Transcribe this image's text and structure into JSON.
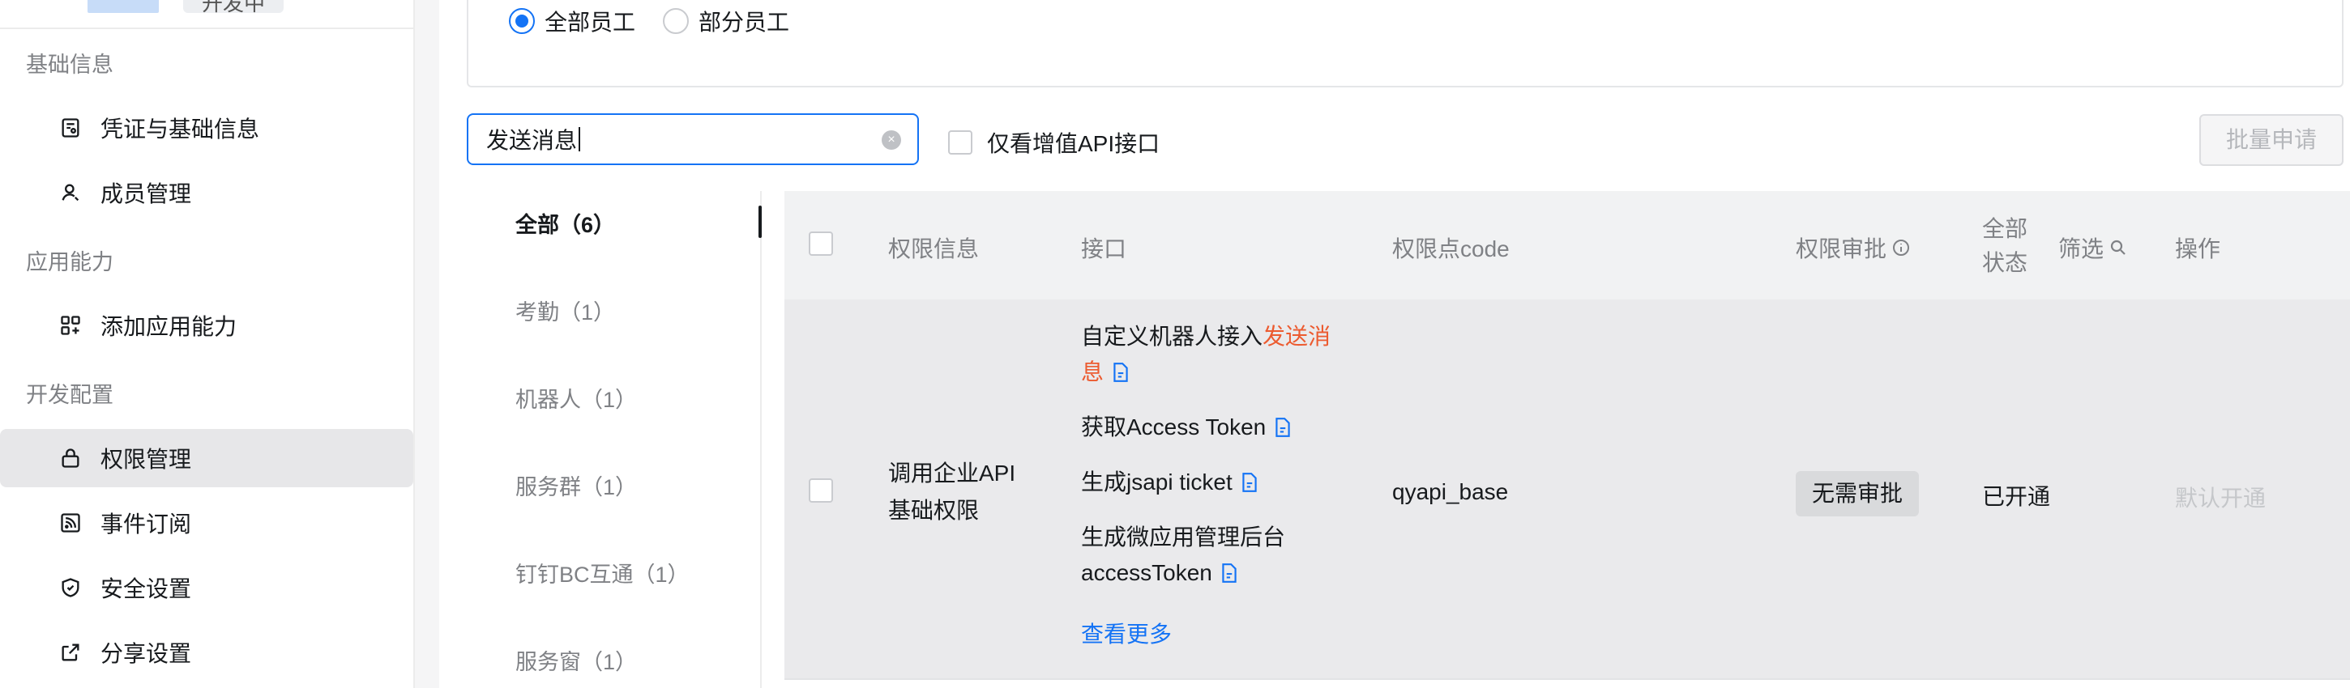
{
  "sidebar": {
    "top_tag": "开发中",
    "groups": {
      "basic": "基础信息",
      "capability": "应用能力",
      "dev": "开发配置"
    },
    "items": [
      {
        "label": "凭证与基础信息",
        "icon": "credential-icon"
      },
      {
        "label": "成员管理",
        "icon": "user-icon"
      },
      {
        "label": "添加应用能力",
        "icon": "add-app-icon"
      },
      {
        "label": "权限管理",
        "icon": "lock-icon",
        "active": true
      },
      {
        "label": "事件订阅",
        "icon": "rss-icon"
      },
      {
        "label": "安全设置",
        "icon": "shield-icon"
      },
      {
        "label": "分享设置",
        "icon": "share-icon"
      }
    ]
  },
  "scope": {
    "options": [
      {
        "label": "全部员工",
        "selected": true
      },
      {
        "label": "部分员工",
        "selected": false
      }
    ]
  },
  "toolbar": {
    "search_value": "发送消息",
    "value_added_only_label": "仅看增值API接口",
    "batch_apply_label": "批量申请"
  },
  "categories": [
    {
      "label": "全部（6）",
      "active": true
    },
    {
      "label": "考勤（1）"
    },
    {
      "label": "机器人（1）"
    },
    {
      "label": "服务群（1）"
    },
    {
      "label": "钉钉BC互通（1）"
    },
    {
      "label": "服务窗（1）"
    }
  ],
  "table": {
    "headers": {
      "permission_info": "权限信息",
      "api": "接口",
      "code": "权限点code",
      "approval": "权限审批",
      "status_line1": "全部",
      "status_line2": "状态",
      "filter": "筛选",
      "action": "操作"
    },
    "rows": [
      {
        "permission_line1": "调用企业API",
        "permission_line2": "基础权限",
        "apis": {
          "api1_prefix": "自定义机器人接入",
          "api1_highlight_a": "发送消",
          "api1_highlight_b": "息",
          "api2": "获取Access Token",
          "api3": "生成jsapi ticket",
          "api4_line1": "生成微应用管理后台",
          "api4_line2": "accessToken"
        },
        "more_label": "查看更多",
        "code": "qyapi_base",
        "approval_tag": "无需审批",
        "status": "已开通",
        "action": "默认开通"
      }
    ]
  },
  "colors": {
    "accent": "#1473f5",
    "highlight": "#ec5b30",
    "muted": "#7f8185"
  }
}
